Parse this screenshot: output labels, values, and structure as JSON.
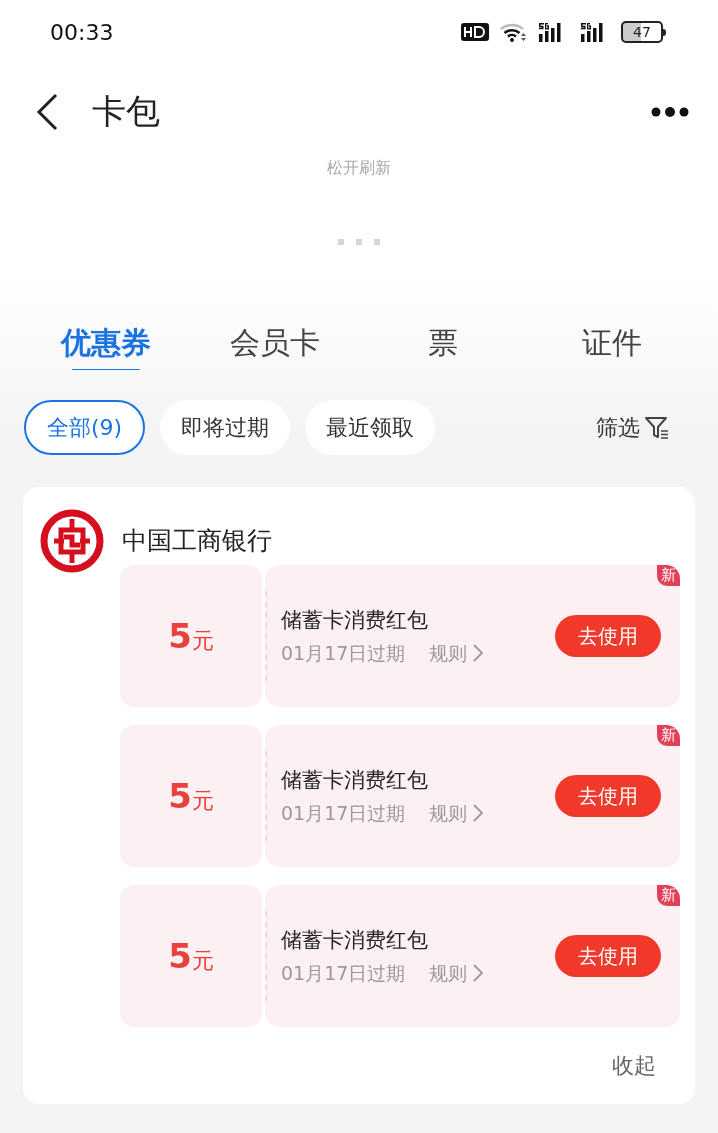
{
  "status_bar": {
    "time": "00:33",
    "battery": "47"
  },
  "header": {
    "title": "卡包"
  },
  "refresh": {
    "hint": "松开刷新"
  },
  "tabs": [
    {
      "label": "优惠券",
      "selected": true
    },
    {
      "label": "会员卡",
      "selected": false
    },
    {
      "label": "票",
      "selected": false
    },
    {
      "label": "证件",
      "selected": false
    }
  ],
  "filters": [
    {
      "label": "全部(9)",
      "selected": true
    },
    {
      "label": "即将过期",
      "selected": false
    },
    {
      "label": "最近领取",
      "selected": false
    }
  ],
  "filter_button": "筛选",
  "bank": {
    "name": "中国工商银行"
  },
  "coupons": [
    {
      "amount": "5",
      "unit": "元",
      "title": "储蓄卡消费红包",
      "expiry": "01月17日过期",
      "rules": "规则",
      "action": "去使用",
      "badge": "新"
    },
    {
      "amount": "5",
      "unit": "元",
      "title": "储蓄卡消费红包",
      "expiry": "01月17日过期",
      "rules": "规则",
      "action": "去使用",
      "badge": "新"
    },
    {
      "amount": "5",
      "unit": "元",
      "title": "储蓄卡消费红包",
      "expiry": "01月17日过期",
      "rules": "规则",
      "action": "去使用",
      "badge": "新"
    }
  ],
  "collapse": "收起"
}
